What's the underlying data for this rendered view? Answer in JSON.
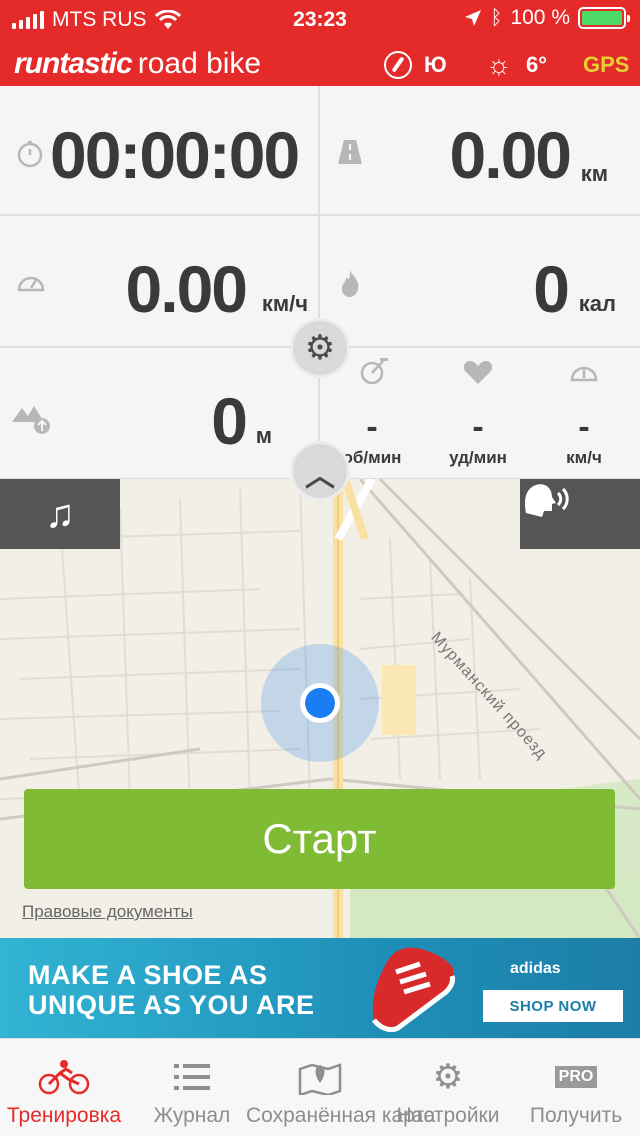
{
  "status_bar": {
    "carrier": "MTS RUS",
    "time": "23:23",
    "battery": "100 %"
  },
  "app_bar": {
    "brand_main": "runtastic",
    "brand_sub": "road bike",
    "direction": "Ю",
    "temperature": "6°",
    "gps": "GPS"
  },
  "stats": {
    "duration": "00:00:00",
    "distance": {
      "value": "0.00",
      "unit": "км"
    },
    "speed": {
      "value": "0.00",
      "unit": "км/ч"
    },
    "calories": {
      "value": "0",
      "unit": "кал"
    },
    "elevation": {
      "value": "0",
      "unit": "м"
    },
    "cadence": {
      "value": "-",
      "unit": "об/мин"
    },
    "heart_rate": {
      "value": "-",
      "unit": "уд/мин"
    },
    "max_speed": {
      "value": "-",
      "unit": "км/ч"
    }
  },
  "map": {
    "street_label": "Мурманский проезд",
    "start_button": "Старт",
    "legal_link": "Правовые документы"
  },
  "ad": {
    "line1": "MAKE A SHOE AS",
    "line2": "UNIQUE AS YOU ARE",
    "brand": "adidas",
    "cta": "SHOP NOW"
  },
  "tabs": [
    {
      "label": "Тренировка",
      "icon": "cyclist-icon",
      "active": true
    },
    {
      "label": "Журнал",
      "icon": "list-icon",
      "active": false
    },
    {
      "label": "Сохранённая карта",
      "icon": "map-icon",
      "active": false
    },
    {
      "label": "Настройки",
      "icon": "gear-icon",
      "active": false
    },
    {
      "label": "Получить",
      "icon": "pro-badge",
      "badge": "PRO",
      "active": false
    }
  ],
  "colors": {
    "brand_red": "#e52b2a",
    "start_green": "#7fbb34",
    "gps_yellow": "#e4d234",
    "location_blue": "#1a7ef2"
  }
}
